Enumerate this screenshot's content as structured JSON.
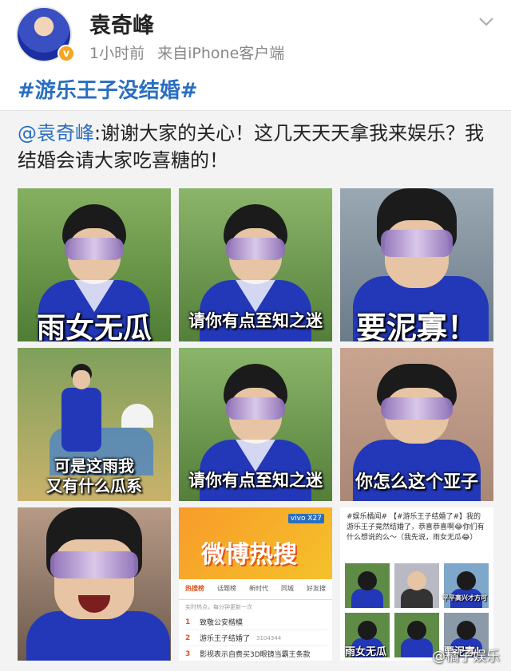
{
  "post": {
    "username": "袁奇峰",
    "time": "1小时前",
    "source": "来自iPhone客户端",
    "hashtag": "#游乐王子没结婚#"
  },
  "repost": {
    "mention": "@袁奇峰",
    "text": ":谢谢大家的关心！这几天天天拿我来娱乐？我结婚会请大家吃喜糖的！"
  },
  "tiles": [
    {
      "caption": "雨女无瓜",
      "caption_size": "big"
    },
    {
      "caption": "请你有点至知之迷",
      "caption_size": "mid"
    },
    {
      "caption": "要泥寡！",
      "caption_size": "big"
    },
    {
      "caption": "可是这雨我\n又有什么瓜系",
      "caption_size": "mid"
    },
    {
      "caption": "请你有点至知之迷",
      "caption_size": "mid"
    },
    {
      "caption": "你怎么这个亚子",
      "caption_size": "mid"
    },
    {
      "caption": "",
      "caption_size": "none"
    }
  ],
  "hot_search": {
    "title": "微博热搜",
    "ad": "vivo X27",
    "tabs": [
      "热搜榜",
      "话题榜",
      "新时代",
      "同城",
      "好友搜"
    ],
    "note": "实时热点，每分钟更新一次",
    "items": [
      {
        "rank": "1",
        "text": "致敬公安楷模",
        "count": ""
      },
      {
        "rank": "2",
        "text": "游乐王子结婚了",
        "count": "3104344"
      },
      {
        "rank": "3",
        "text": "影视表示自费买3D眼镜当霸王条款",
        "count": ""
      }
    ]
  },
  "weibo_card": {
    "line1": "#娱乐橘闻# 【#游乐王子结婚了#】我的游乐王子竟然结婚了，恭喜恭喜啊😂你们有什么想说的么～（我先说，雨女无瓜😂）",
    "captions": [
      "平平高兴才方可",
      "雨女无瓜",
      "要泥寡！"
    ]
  },
  "watermark": "@橘子娱乐",
  "colors": {
    "link": "#2a6ec2",
    "badge": "#f6a623",
    "costume": "#2338b8"
  }
}
